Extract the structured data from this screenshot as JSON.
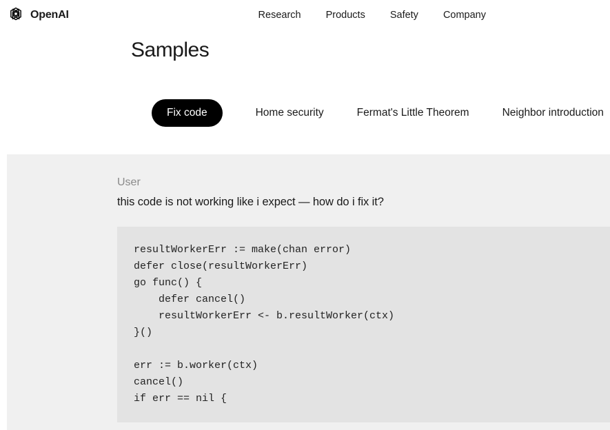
{
  "brand": {
    "name": "OpenAI"
  },
  "nav": {
    "items": [
      "Research",
      "Products",
      "Safety",
      "Company"
    ]
  },
  "page": {
    "title": "Samples"
  },
  "tabs": {
    "items": [
      {
        "label": "Fix code",
        "active": true
      },
      {
        "label": "Home security",
        "active": false
      },
      {
        "label": "Fermat's Little Theorem",
        "active": false
      },
      {
        "label": "Neighbor introduction",
        "active": false
      }
    ]
  },
  "sample": {
    "role": "User",
    "prompt": "this code is not working like i expect — how do i fix it?",
    "code": "resultWorkerErr := make(chan error)\ndefer close(resultWorkerErr)\ngo func() {\n    defer cancel()\n    resultWorkerErr <- b.resultWorker(ctx)\n}()\n\nerr := b.worker(ctx)\ncancel()\nif err == nil {"
  }
}
